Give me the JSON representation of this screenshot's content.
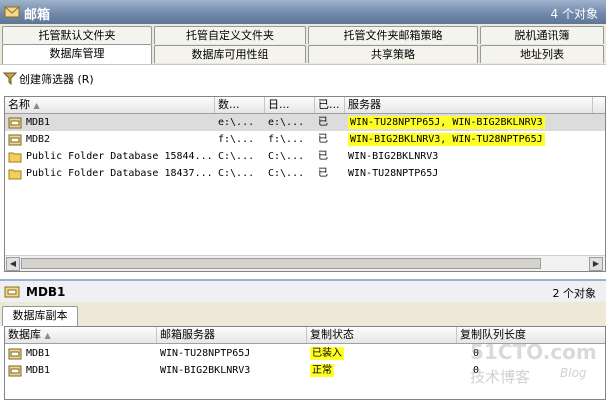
{
  "window": {
    "title": "邮箱",
    "count": "4 个对象"
  },
  "tabs_row1": [
    "托管默认文件夹",
    "托管自定义文件夹",
    "托管文件夹邮箱策略",
    "脱机通讯簿"
  ],
  "tabs_row2": [
    "数据库管理",
    "数据库可用性组",
    "共享策略",
    "地址列表"
  ],
  "toolbar": {
    "filter_label": "创建筛选器 (R)"
  },
  "db_table": {
    "columns": [
      "名称",
      "数...",
      "日...",
      "已...",
      "服务器",
      ""
    ],
    "rows": [
      {
        "name": "MDB1",
        "c2": "e:\\...",
        "c3": "e:\\...",
        "c4": "已",
        "server": "WIN-TU28NPTP65J, WIN-BIG2BKLNRV3",
        "highlight": true,
        "selected": true,
        "icon": "mailbox-db-icon"
      },
      {
        "name": "MDB2",
        "c2": "f:\\...",
        "c3": "f:\\...",
        "c4": "已",
        "server": "WIN-BIG2BKLNRV3, WIN-TU28NPTP65J",
        "highlight": true,
        "selected": false,
        "icon": "mailbox-db-icon"
      },
      {
        "name": "Public Folder Database 15844...",
        "c2": "C:\\...",
        "c3": "C:\\...",
        "c4": "已",
        "server": "WIN-BIG2BKLNRV3",
        "highlight": false,
        "selected": false,
        "icon": "public-folder-db-icon"
      },
      {
        "name": "Public Folder Database 18437...",
        "c2": "C:\\...",
        "c3": "C:\\...",
        "c4": "已",
        "server": "WIN-TU28NPTP65J",
        "highlight": false,
        "selected": false,
        "icon": "public-folder-db-icon"
      }
    ]
  },
  "result_pane": {
    "title": "MDB1",
    "count": "2 个对象"
  },
  "sub_tab": "数据库副本",
  "copy_table": {
    "columns": [
      "数据库",
      "邮箱服务器",
      "复制状态",
      "复制队列长度"
    ],
    "rows": [
      {
        "db": "MDB1",
        "server": "WIN-TU28NPTP65J",
        "status": "已装入",
        "queue": "0"
      },
      {
        "db": "MDB1",
        "server": "WIN-BIG2BKLNRV3",
        "status": "正常",
        "queue": "0"
      }
    ]
  },
  "watermark": {
    "main": "51CTO.com",
    "sub": "技术博客",
    "blog": "Blog"
  },
  "colors": {
    "highlight": "#ffff26",
    "titlebar": "#6f87a8",
    "selection": "#dcdcdc"
  }
}
